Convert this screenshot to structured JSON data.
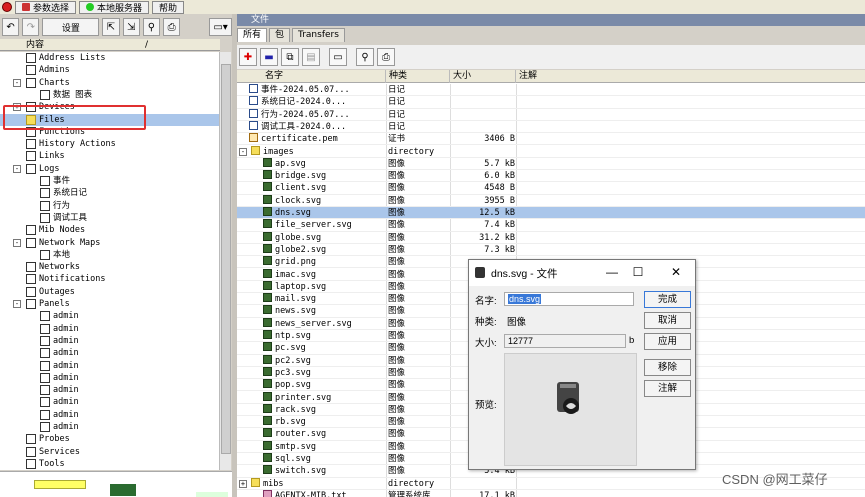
{
  "topbar": {
    "btn1": "参数选择",
    "btn2": "本地服务器",
    "btn3": "帮助"
  },
  "toolbar": {
    "settings": "设置"
  },
  "tree": {
    "header": "内容",
    "items": [
      {
        "label": "Address Lists",
        "indent": 1,
        "exp": ""
      },
      {
        "label": "Admins",
        "indent": 1,
        "exp": ""
      },
      {
        "label": "Charts",
        "indent": 1,
        "exp": "-"
      },
      {
        "label": "数据 图表",
        "indent": 2,
        "exp": ""
      },
      {
        "label": "Devices",
        "indent": 1,
        "exp": "+"
      },
      {
        "label": "Files",
        "indent": 1,
        "exp": "",
        "sel": true
      },
      {
        "label": "Functions",
        "indent": 1,
        "exp": ""
      },
      {
        "label": "History Actions",
        "indent": 1,
        "exp": ""
      },
      {
        "label": "Links",
        "indent": 1,
        "exp": ""
      },
      {
        "label": "Logs",
        "indent": 1,
        "exp": "-"
      },
      {
        "label": "事件",
        "indent": 2,
        "exp": ""
      },
      {
        "label": "系统日记",
        "indent": 2,
        "exp": ""
      },
      {
        "label": "行为",
        "indent": 2,
        "exp": ""
      },
      {
        "label": "调试工具",
        "indent": 2,
        "exp": ""
      },
      {
        "label": "Mib Nodes",
        "indent": 1,
        "exp": ""
      },
      {
        "label": "Network Maps",
        "indent": 1,
        "exp": "-"
      },
      {
        "label": "本地",
        "indent": 2,
        "exp": ""
      },
      {
        "label": "Networks",
        "indent": 1,
        "exp": ""
      },
      {
        "label": "Notifications",
        "indent": 1,
        "exp": ""
      },
      {
        "label": "Outages",
        "indent": 1,
        "exp": ""
      },
      {
        "label": "Panels",
        "indent": 1,
        "exp": "-"
      },
      {
        "label": "admin",
        "indent": 2,
        "exp": ""
      },
      {
        "label": "admin",
        "indent": 2,
        "exp": ""
      },
      {
        "label": "admin",
        "indent": 2,
        "exp": ""
      },
      {
        "label": "admin",
        "indent": 2,
        "exp": ""
      },
      {
        "label": "admin",
        "indent": 2,
        "exp": ""
      },
      {
        "label": "admin",
        "indent": 2,
        "exp": ""
      },
      {
        "label": "admin",
        "indent": 2,
        "exp": ""
      },
      {
        "label": "admin",
        "indent": 2,
        "exp": ""
      },
      {
        "label": "admin",
        "indent": 2,
        "exp": ""
      },
      {
        "label": "admin",
        "indent": 2,
        "exp": ""
      },
      {
        "label": "Probes",
        "indent": 1,
        "exp": ""
      },
      {
        "label": "Services",
        "indent": 1,
        "exp": ""
      },
      {
        "label": "Tools",
        "indent": 1,
        "exp": ""
      }
    ]
  },
  "pane": {
    "title": "文件",
    "tabs": [
      "所有",
      "包",
      "Transfers"
    ]
  },
  "grid": {
    "columns": [
      "名字",
      "种类",
      "大小",
      "注解"
    ],
    "rows": [
      {
        "name": "事件-2024.05.07...",
        "type": "日记",
        "size": "",
        "icon": "doc",
        "lvl": 1
      },
      {
        "name": "系统日记-2024.0...",
        "type": "日记",
        "size": "",
        "icon": "doc",
        "lvl": 1
      },
      {
        "name": "行为-2024.05.07...",
        "type": "日记",
        "size": "",
        "icon": "doc",
        "lvl": 1
      },
      {
        "name": "调试工具-2024.0...",
        "type": "日记",
        "size": "",
        "icon": "doc",
        "lvl": 1
      },
      {
        "name": "certificate.pem",
        "type": "证书",
        "size": "3406 B",
        "icon": "cert",
        "lvl": 1
      },
      {
        "name": "images",
        "type": "directory",
        "size": "",
        "icon": "fold",
        "lvl": 0,
        "exp": "-"
      },
      {
        "name": "ap.svg",
        "type": "图像",
        "size": "5.7 kB",
        "icon": "img",
        "lvl": 2
      },
      {
        "name": "bridge.svg",
        "type": "图像",
        "size": "6.0 kB",
        "icon": "img",
        "lvl": 2
      },
      {
        "name": "client.svg",
        "type": "图像",
        "size": "4548 B",
        "icon": "img",
        "lvl": 2
      },
      {
        "name": "clock.svg",
        "type": "图像",
        "size": "3955 B",
        "icon": "img",
        "lvl": 2
      },
      {
        "name": "dns.svg",
        "type": "图像",
        "size": "12.5 kB",
        "icon": "img",
        "lvl": 2,
        "sel": true
      },
      {
        "name": "file_server.svg",
        "type": "图像",
        "size": "7.4 kB",
        "icon": "img",
        "lvl": 2
      },
      {
        "name": "globe.svg",
        "type": "图像",
        "size": "31.2 kB",
        "icon": "img",
        "lvl": 2
      },
      {
        "name": "globe2.svg",
        "type": "图像",
        "size": "7.3 kB",
        "icon": "img",
        "lvl": 2
      },
      {
        "name": "grid.png",
        "type": "图像",
        "size": "",
        "icon": "img",
        "lvl": 2
      },
      {
        "name": "imac.svg",
        "type": "图像",
        "size": "",
        "icon": "img",
        "lvl": 2
      },
      {
        "name": "laptop.svg",
        "type": "图像",
        "size": "",
        "icon": "img",
        "lvl": 2
      },
      {
        "name": "mail.svg",
        "type": "图像",
        "size": "",
        "icon": "img",
        "lvl": 2
      },
      {
        "name": "news.svg",
        "type": "图像",
        "size": "",
        "icon": "img",
        "lvl": 2
      },
      {
        "name": "news_server.svg",
        "type": "图像",
        "size": "",
        "icon": "img",
        "lvl": 2
      },
      {
        "name": "ntp.svg",
        "type": "图像",
        "size": "",
        "icon": "img",
        "lvl": 2
      },
      {
        "name": "pc.svg",
        "type": "图像",
        "size": "",
        "icon": "img",
        "lvl": 2
      },
      {
        "name": "pc2.svg",
        "type": "图像",
        "size": "",
        "icon": "img",
        "lvl": 2
      },
      {
        "name": "pc3.svg",
        "type": "图像",
        "size": "",
        "icon": "img",
        "lvl": 2
      },
      {
        "name": "pop.svg",
        "type": "图像",
        "size": "",
        "icon": "img",
        "lvl": 2
      },
      {
        "name": "printer.svg",
        "type": "图像",
        "size": "",
        "icon": "img",
        "lvl": 2
      },
      {
        "name": "rack.svg",
        "type": "图像",
        "size": "",
        "icon": "img",
        "lvl": 2
      },
      {
        "name": "rb.svg",
        "type": "图像",
        "size": "",
        "icon": "img",
        "lvl": 2
      },
      {
        "name": "router.svg",
        "type": "图像",
        "size": "",
        "icon": "img",
        "lvl": 2
      },
      {
        "name": "smtp.svg",
        "type": "图像",
        "size": "",
        "icon": "img",
        "lvl": 2
      },
      {
        "name": "sql.svg",
        "type": "图像",
        "size": "",
        "icon": "img",
        "lvl": 2
      },
      {
        "name": "switch.svg",
        "type": "图像",
        "size": "5.4 kB",
        "icon": "img",
        "lvl": 2
      },
      {
        "name": "mibs",
        "type": "directory",
        "size": "",
        "icon": "fold",
        "lvl": 0,
        "exp": "+"
      },
      {
        "name": "AGENTX-MIB.txt",
        "type": "管理系统库",
        "size": "17.1 kB",
        "icon": "txt",
        "lvl": 2
      }
    ]
  },
  "dialog": {
    "title": "dns.svg - 文件",
    "name_label": "名字:",
    "name_value": "dns.svg",
    "type_label": "种类:",
    "type_value": "图像",
    "size_label": "大小:",
    "size_value": "12777",
    "size_unit": "b",
    "preview_label": "预览:",
    "btn_done": "完成",
    "btn_cancel": "取消",
    "btn_apply": "应用",
    "btn_remove": "移除",
    "btn_note": "注解",
    "win_min": "—",
    "win_max": "☐",
    "win_close": "✕"
  },
  "watermark": "CSDN @网工菜仔"
}
